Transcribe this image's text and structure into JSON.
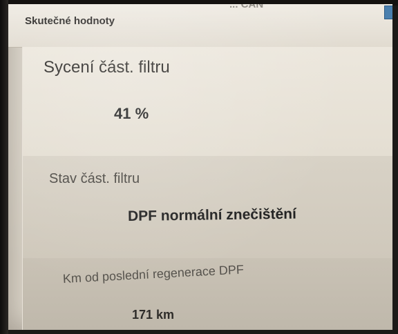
{
  "header": {
    "title": "Skutečné hodnoty",
    "overflow_text": "... CAN"
  },
  "readings": [
    {
      "label": "Sycení část. filtru",
      "value": "41 %"
    },
    {
      "label": "Stav část. filtru",
      "value": "DPF normální znečištění"
    },
    {
      "label": "Km od poslední regenerace DPF",
      "value": "171 km"
    }
  ],
  "colors": {
    "screen_background": "#d9d3c7",
    "title_bar": "#e9e4da",
    "accent_button": "#4a7fae"
  }
}
